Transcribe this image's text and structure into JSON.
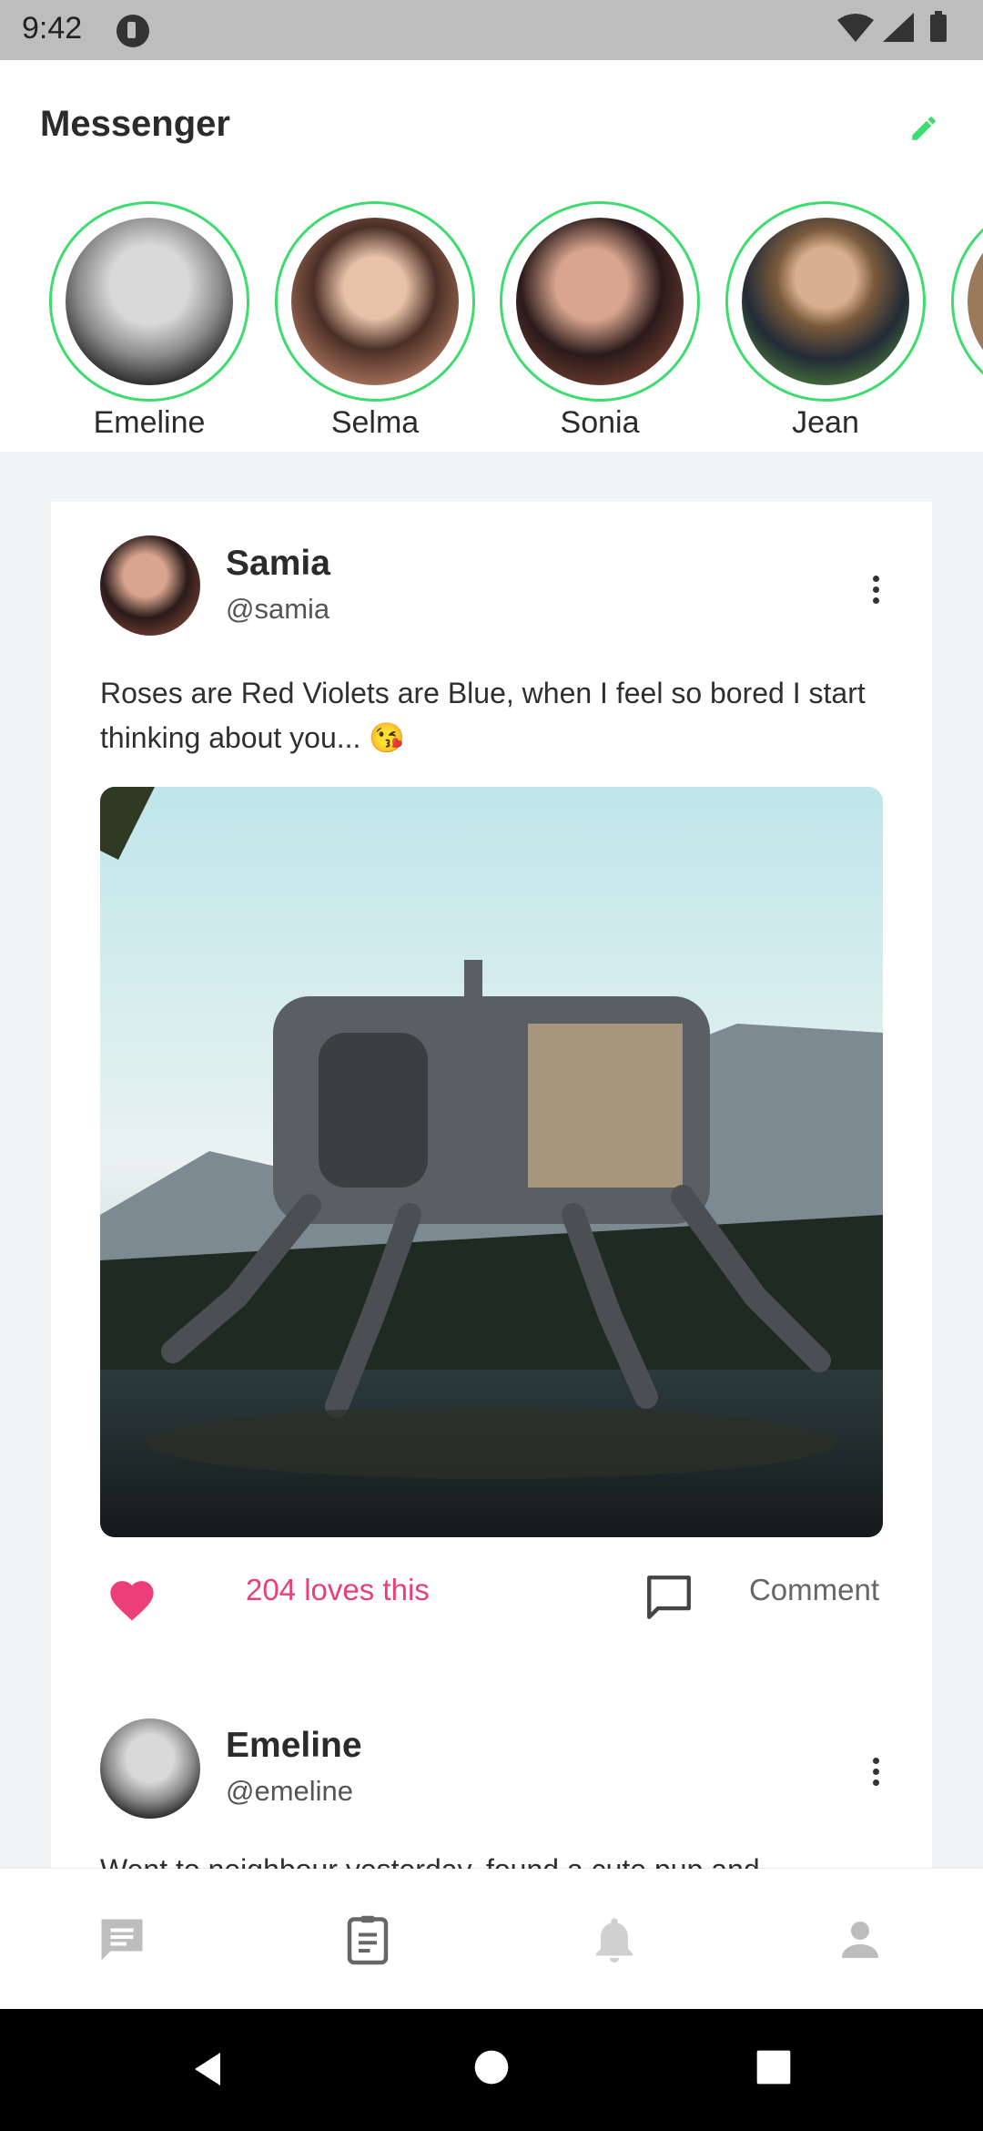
{
  "status_bar": {
    "time": "9:42"
  },
  "header": {
    "title": "Messenger"
  },
  "stories": [
    {
      "name": "Emeline"
    },
    {
      "name": "Selma"
    },
    {
      "name": "Sonia"
    },
    {
      "name": "Jean"
    }
  ],
  "posts": [
    {
      "author": "Samia",
      "handle": "@samia",
      "text": "Roses are Red Violets are Blue, when I feel so bored I start thinking about you... 😘",
      "likes": "204 loves this",
      "comment_label": "Comment"
    },
    {
      "author": "Emeline",
      "handle": "@emeline",
      "text": "Went to neighbour yesterday, found a cute pup and"
    }
  ],
  "colors": {
    "accent_green": "#3ddc6e",
    "like_pink": "#ec3f7a",
    "status_bar": "#bdbdbd"
  },
  "bottom_nav": [
    {
      "icon": "chat-icon"
    },
    {
      "icon": "clipboard-icon"
    },
    {
      "icon": "bell-icon"
    },
    {
      "icon": "person-icon"
    }
  ],
  "system_nav": [
    {
      "icon": "back-icon"
    },
    {
      "icon": "home-icon"
    },
    {
      "icon": "recents-icon"
    }
  ]
}
